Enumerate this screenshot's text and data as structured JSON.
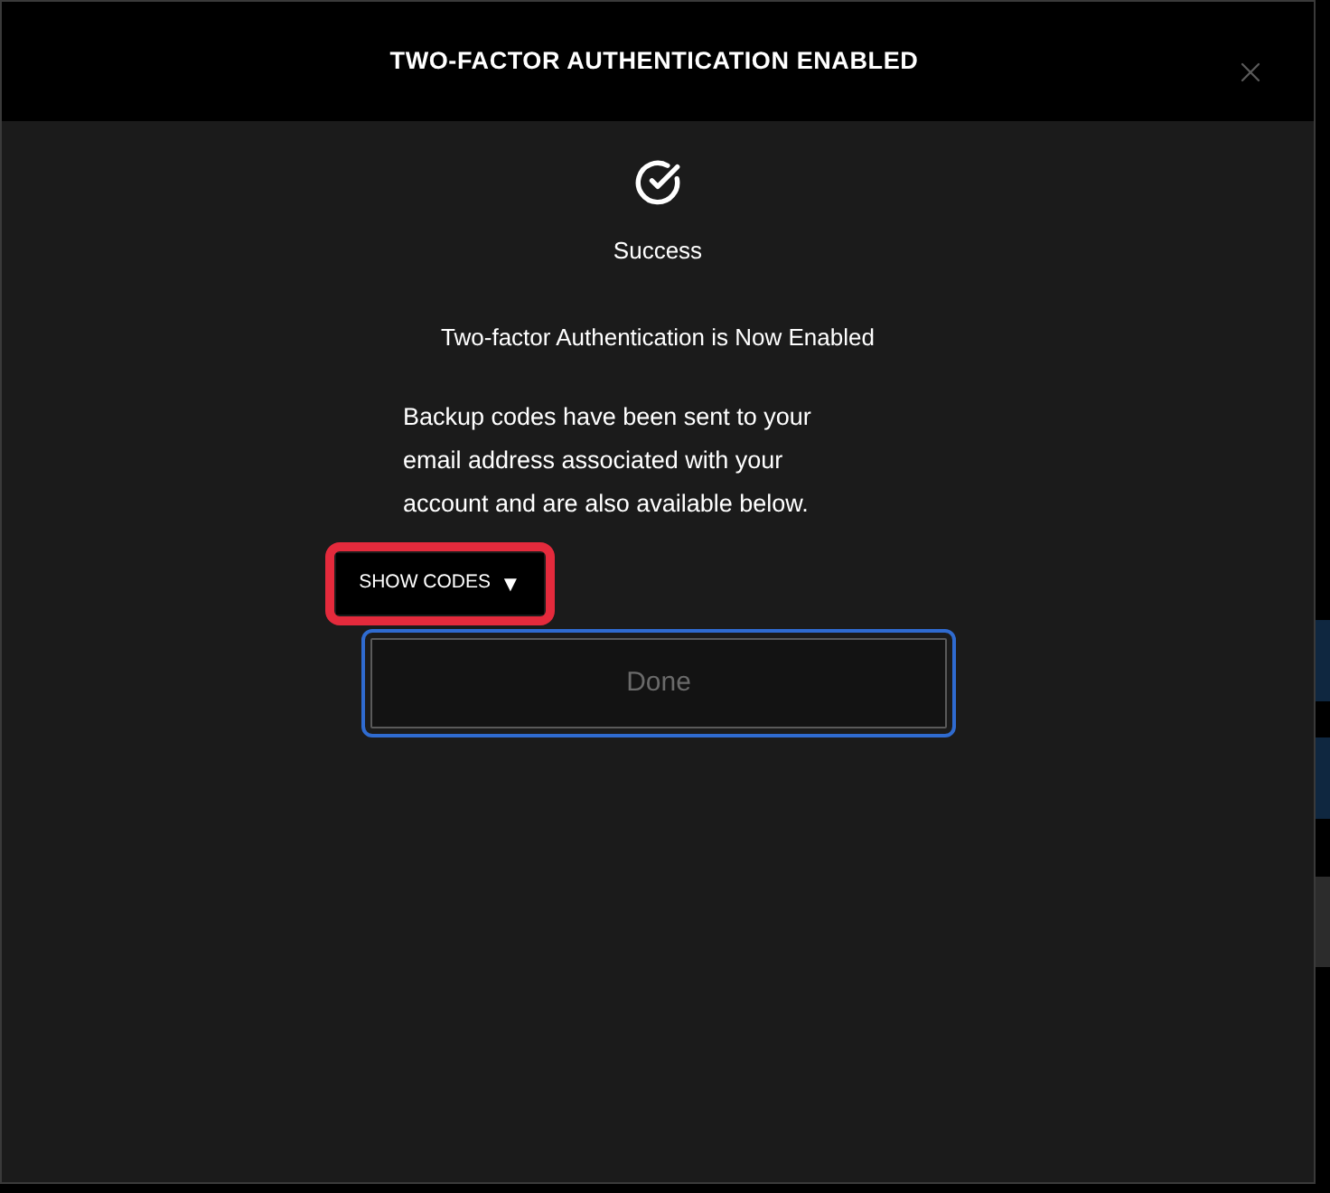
{
  "dialog": {
    "title": "TWO-FACTOR AUTHENTICATION ENABLED"
  },
  "status": {
    "heading": "Success"
  },
  "message": "Two-factor Authentication is Now Enabled",
  "description": "Backup codes have been sent to your email address associated with your account and are also available below.",
  "codes_toggle": {
    "label": "SHOW CODES",
    "arrow": "▼",
    "highlighted": true
  },
  "done_button": {
    "label": "Done",
    "disabled": true,
    "focused": true
  }
}
